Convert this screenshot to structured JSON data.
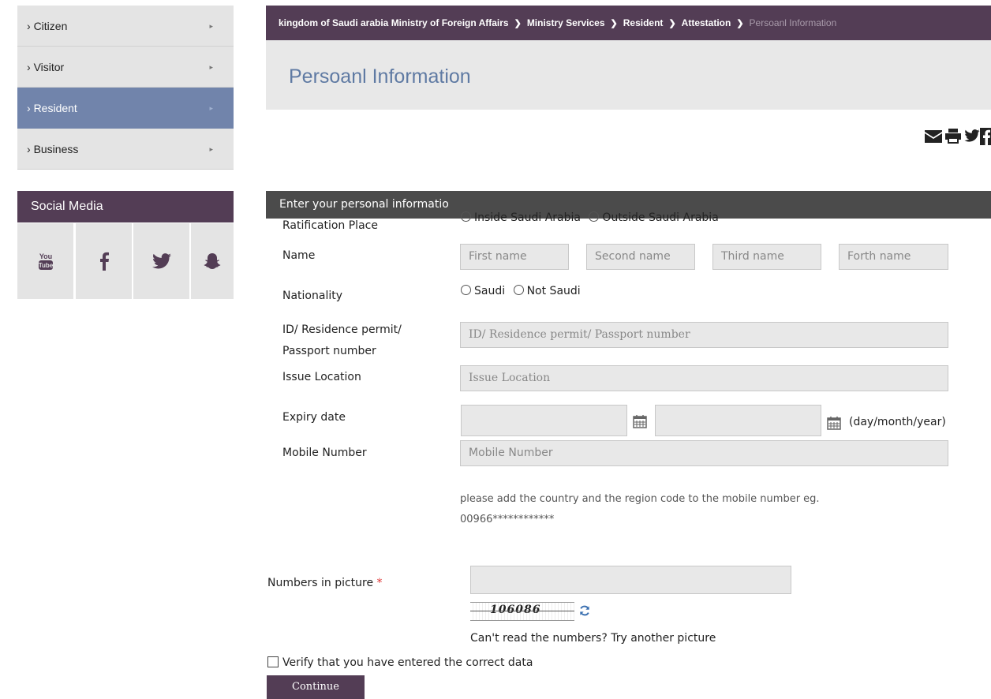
{
  "sidebar": {
    "items": [
      {
        "label": "Citizen"
      },
      {
        "label": "Visitor"
      },
      {
        "label": "Resident"
      },
      {
        "label": "Business"
      }
    ],
    "arrow": "›",
    "item_arrow": "▸"
  },
  "social": {
    "title": "Social Media",
    "icons": [
      "youtube-icon",
      "facebook-icon",
      "twitter-icon",
      "snapchat-icon"
    ],
    "youtube_text": "You Tube"
  },
  "breadcrumb": {
    "items": [
      "kingdom of Saudi arabia Ministry of Foreign Affairs",
      "Ministry Services",
      "Resident",
      "Attestation"
    ],
    "current": "Persoanl Information",
    "separator": "❯"
  },
  "page_title": "Persoanl Information",
  "share_icons": [
    "mail-icon",
    "print-icon",
    "twitter-icon",
    "facebook-icon"
  ],
  "form": {
    "section_title": "Enter your personal informatio",
    "ratification": {
      "label": "Ratification Place",
      "options": [
        "Inside Saudi Arabia",
        "Outside Saudi Arabia"
      ]
    },
    "name": {
      "label": "Name",
      "placeholders": [
        "First name",
        "Second name",
        "Third name",
        "Forth name"
      ]
    },
    "nationality": {
      "label": "Nationality",
      "options": [
        "Saudi",
        "Not Saudi"
      ]
    },
    "id": {
      "label_line1": "ID/ Residence permit/",
      "label_line2": "Passport number",
      "placeholder": "ID/ Residence permit/ Passport number"
    },
    "issue_location": {
      "label": "Issue Location",
      "placeholder": "Issue Location"
    },
    "expiry": {
      "label": "Expiry date",
      "format": "(day/month/year)"
    },
    "mobile": {
      "label": "Mobile Number",
      "placeholder": "Mobile Number",
      "hint_line1": "please add the country and the region code to the mobile number eg.",
      "hint_line2": "00966************"
    },
    "captcha": {
      "label": "Numbers in picture",
      "required_mark": "*",
      "code": "106086",
      "refresh_hint": "Can't read the numbers? Try another picture"
    },
    "verify_label": "Verify that you have entered the correct data",
    "continue_label": "Continue"
  },
  "colors": {
    "brand_purple": "#533d55",
    "active_blue": "#7184ab",
    "title_blue": "#5f7aa3"
  }
}
